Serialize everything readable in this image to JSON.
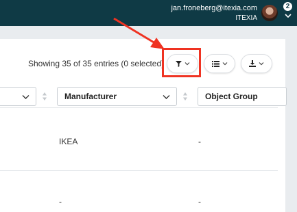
{
  "header": {
    "user_email": "jan.froneberg@itexia.com",
    "user_org": "ITEXIA",
    "notification_count": "2"
  },
  "toolbar": {
    "entries_info": "Showing 35 of 35 entries (0 selected)",
    "filter_icon": "filter-icon",
    "columns_icon": "list-icon",
    "export_icon": "download-icon"
  },
  "table": {
    "columns": [
      {
        "label": ""
      },
      {
        "label": "Manufacturer"
      },
      {
        "label": "Object Group"
      }
    ],
    "rows": [
      {
        "manufacturer": "IKEA",
        "object_group": "-"
      },
      {
        "manufacturer": "-",
        "object_group": "-"
      }
    ]
  },
  "colors": {
    "topbar": "#0f3a45",
    "highlight": "#ef3322"
  }
}
